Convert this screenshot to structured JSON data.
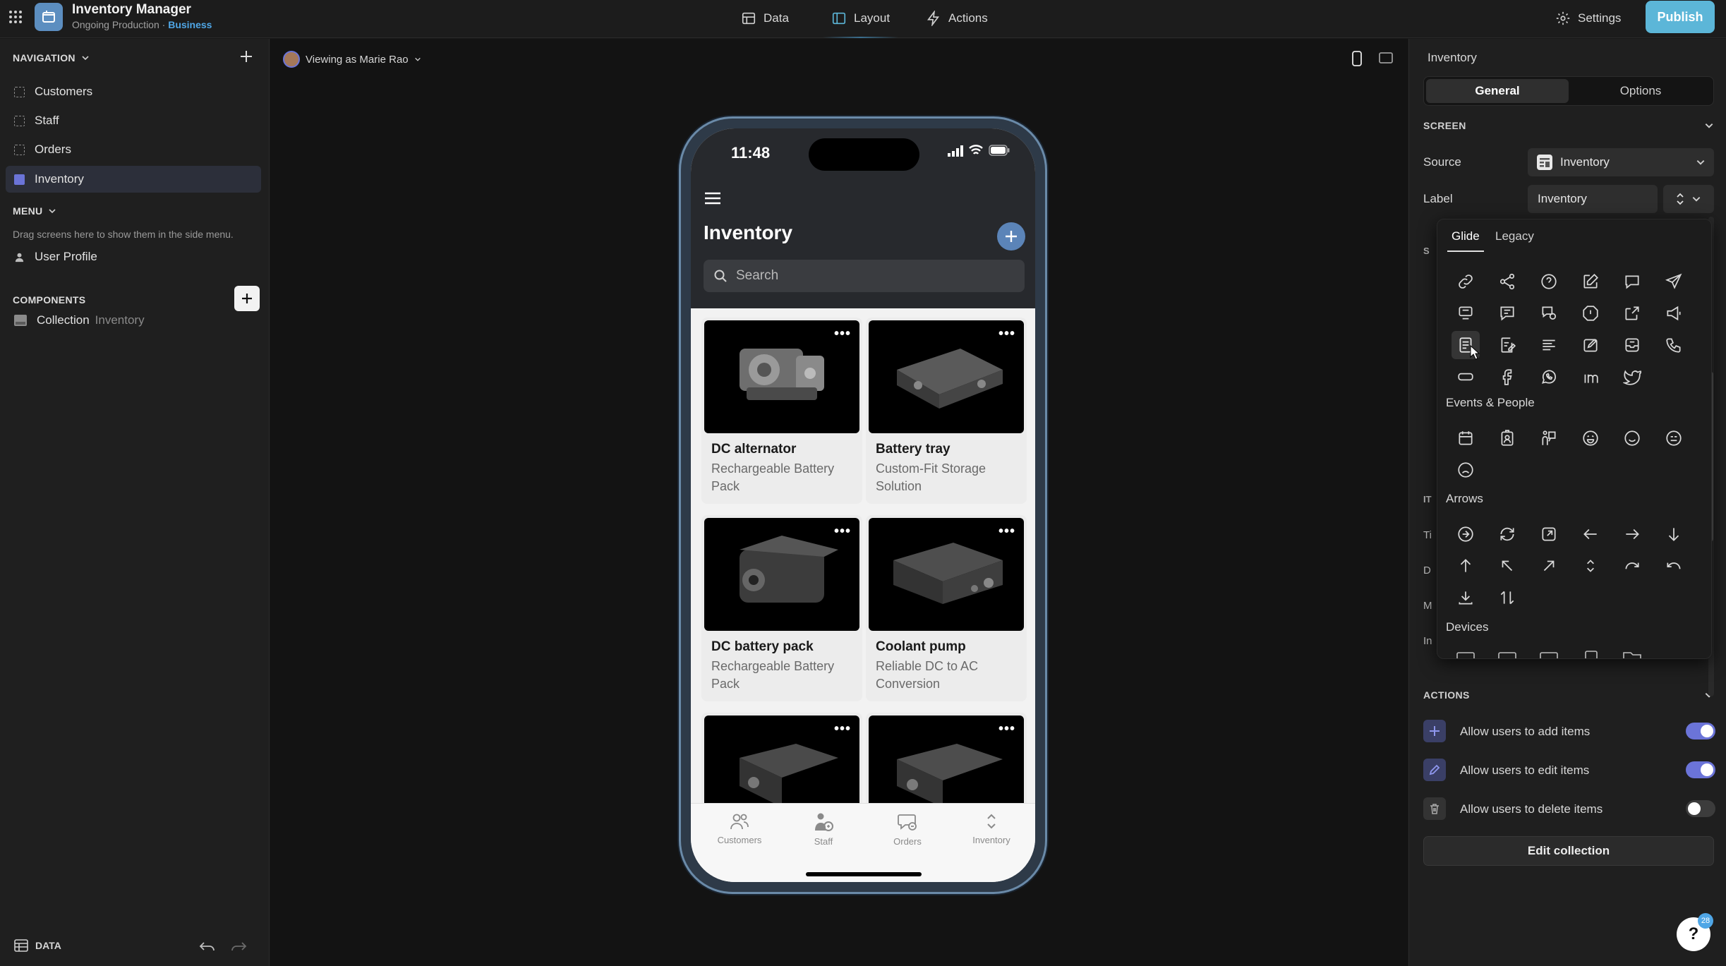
{
  "app": {
    "title": "Inventory Manager",
    "subtitle_prefix": "Ongoing Production · ",
    "subtitle_plan": "Business"
  },
  "topnav": {
    "tabs": [
      {
        "label": "Data",
        "icon": "table-icon"
      },
      {
        "label": "Layout",
        "icon": "layout-icon",
        "active": true
      },
      {
        "label": "Actions",
        "icon": "bolt-icon"
      }
    ],
    "settings_label": "Settings",
    "publish_label": "Publish"
  },
  "left": {
    "navigation_header": "NAVIGATION",
    "nav_items": [
      {
        "label": "Customers"
      },
      {
        "label": "Staff"
      },
      {
        "label": "Orders"
      },
      {
        "label": "Inventory",
        "selected": true
      }
    ],
    "menu_header": "MENU",
    "menu_hint": "Drag screens here to show them in the side menu.",
    "menu_items": [
      {
        "label": "User Profile"
      }
    ],
    "components_header": "COMPONENTS",
    "components": [
      {
        "label": "Collection",
        "source": "Inventory"
      }
    ],
    "footer_label": "DATA"
  },
  "canvas": {
    "viewing_as": "Viewing as Marie Rao"
  },
  "phone": {
    "time": "11:48",
    "title": "Inventory",
    "search_placeholder": "Search",
    "cards": [
      {
        "title": "DC alternator",
        "subtitle": "Rechargeable Battery Pack"
      },
      {
        "title": "Battery tray",
        "subtitle": "Custom-Fit Storage Solution"
      },
      {
        "title": "DC battery pack",
        "subtitle": "Rechargeable Battery Pack"
      },
      {
        "title": "Coolant pump",
        "subtitle": "Reliable DC to AC Conversion"
      },
      {
        "title": "",
        "subtitle": ""
      },
      {
        "title": "",
        "subtitle": ""
      }
    ],
    "tabs": [
      {
        "label": "Customers",
        "icon": "people-icon"
      },
      {
        "label": "Staff",
        "icon": "staff-icon"
      },
      {
        "label": "Orders",
        "icon": "chat-icon"
      },
      {
        "label": "Inventory",
        "icon": "sort-icon"
      }
    ]
  },
  "right": {
    "title": "Inventory",
    "segments": [
      "General",
      "Options"
    ],
    "screen_header": "SCREEN",
    "source_label": "Source",
    "source_value": "Inventory",
    "label_label": "Label",
    "label_value": "Inventory",
    "partial_labels": [
      "S",
      "IT",
      "Ti",
      "D",
      "M",
      "In"
    ],
    "picker": {
      "tabs": [
        "Glide",
        "Legacy"
      ],
      "categories": [
        "Events & People",
        "Arrows",
        "Devices"
      ]
    },
    "actions_header": "ACTIONS",
    "actions": [
      {
        "label": "Allow users to add items",
        "on": true,
        "icon": "plus-icon"
      },
      {
        "label": "Allow users to edit items",
        "on": true,
        "icon": "pencil-icon"
      },
      {
        "label": "Allow users to delete items",
        "on": false,
        "icon": "trash-icon"
      }
    ],
    "edit_collection_label": "Edit collection",
    "help_badge": "28"
  },
  "colors": {
    "accent": "#5cb6d8",
    "toggle_on": "#6b74d8",
    "plan_blue": "#4fa6e6"
  }
}
